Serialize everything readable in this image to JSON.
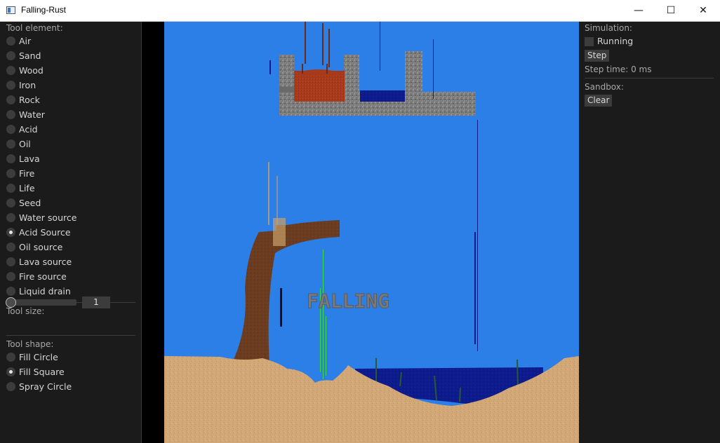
{
  "window": {
    "title": "Falling-Rust",
    "minimize": "—",
    "maximize": "☐",
    "close": "✕"
  },
  "left_panel": {
    "tool_element_heading": "Tool element:",
    "elements": [
      {
        "label": "Air",
        "selected": false
      },
      {
        "label": "Sand",
        "selected": false
      },
      {
        "label": "Wood",
        "selected": false
      },
      {
        "label": "Iron",
        "selected": false
      },
      {
        "label": "Rock",
        "selected": false
      },
      {
        "label": "Water",
        "selected": false
      },
      {
        "label": "Acid",
        "selected": false
      },
      {
        "label": "Oil",
        "selected": false
      },
      {
        "label": "Lava",
        "selected": false
      },
      {
        "label": "Fire",
        "selected": false
      },
      {
        "label": "Life",
        "selected": false
      },
      {
        "label": "Seed",
        "selected": false
      },
      {
        "label": "Water source",
        "selected": false
      },
      {
        "label": "Acid Source",
        "selected": true
      },
      {
        "label": "Oil source",
        "selected": false
      },
      {
        "label": "Lava source",
        "selected": false
      },
      {
        "label": "Fire source",
        "selected": false
      },
      {
        "label": "Liquid drain",
        "selected": false
      }
    ],
    "tool_size_heading": "Tool size:",
    "tool_size_value": "1",
    "tool_shape_heading": "Tool shape:",
    "shapes": [
      {
        "label": "Fill Circle",
        "selected": false
      },
      {
        "label": "Fill Square",
        "selected": true
      },
      {
        "label": "Spray Circle",
        "selected": false
      }
    ]
  },
  "right_panel": {
    "simulation_heading": "Simulation:",
    "running_label": "Running",
    "running_checked": false,
    "step_button": "Step",
    "step_time": "Step time: 0 ms",
    "sandbox_heading": "Sandbox:",
    "clear_button": "Clear"
  },
  "canvas": {
    "text": "FALLING",
    "colors": {
      "sky": "#2b7fe6",
      "sand": "#d2a877",
      "rock": "#7d7d7d",
      "water": "#0c1a8a",
      "wood": "#6a3a1e",
      "lava": "#a8391c",
      "acid": "#3bdc3b"
    }
  }
}
